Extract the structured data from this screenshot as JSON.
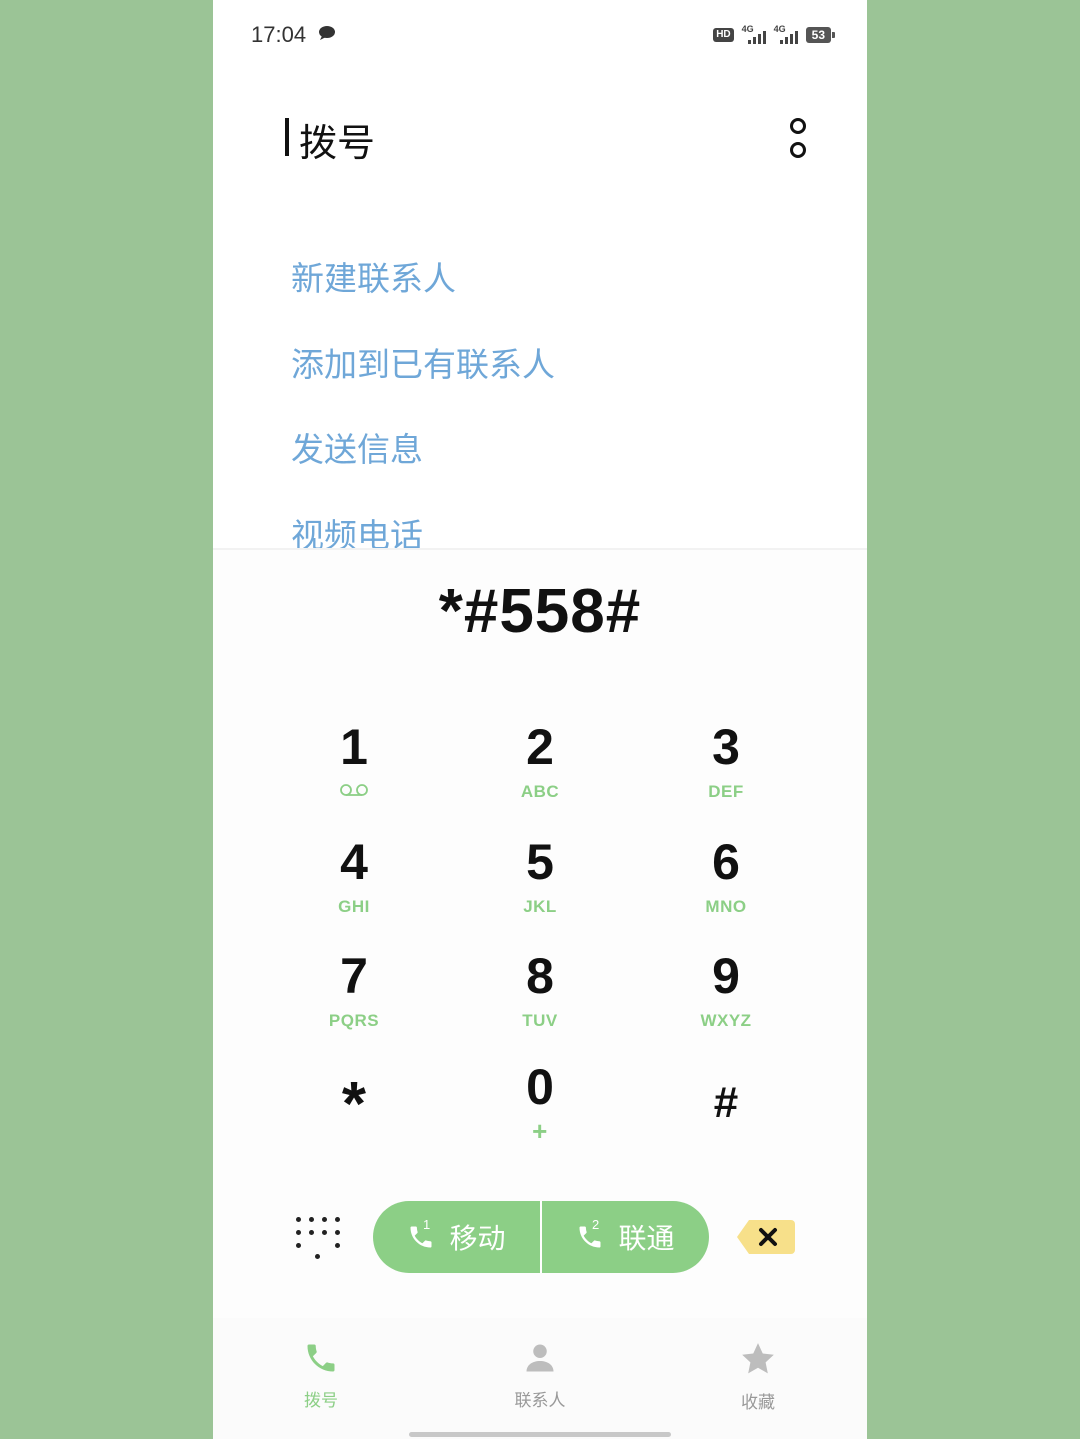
{
  "status_bar": {
    "time": "17:04",
    "icons": [
      "message-icon",
      "hd-icon",
      "4g-signal-sim1-icon",
      "4g-signal-sim2-icon"
    ],
    "hd_label": "HD",
    "network_label": "4G",
    "battery": "53"
  },
  "header": {
    "title": "拨号",
    "more_icon": "more-vertical-icon"
  },
  "menu": {
    "items": [
      {
        "label": "新建联系人"
      },
      {
        "label": "添加到已有联系人"
      },
      {
        "label": "发送信息"
      },
      {
        "label": "视频电话"
      }
    ]
  },
  "dialer": {
    "number": "*#558#",
    "keys": [
      {
        "digit": "1",
        "letters": "",
        "icon": "voicemail-icon"
      },
      {
        "digit": "2",
        "letters": "ABC"
      },
      {
        "digit": "3",
        "letters": "DEF"
      },
      {
        "digit": "4",
        "letters": "GHI"
      },
      {
        "digit": "5",
        "letters": "JKL"
      },
      {
        "digit": "6",
        "letters": "MNO"
      },
      {
        "digit": "7",
        "letters": "PQRS"
      },
      {
        "digit": "8",
        "letters": "TUV"
      },
      {
        "digit": "9",
        "letters": "WXYZ"
      },
      {
        "digit": "*",
        "letters": ""
      },
      {
        "digit": "0",
        "letters": "+"
      },
      {
        "digit": "#",
        "letters": ""
      }
    ],
    "call_buttons": [
      {
        "sim": "1",
        "label": "移动"
      },
      {
        "sim": "2",
        "label": "联通"
      }
    ],
    "colors": {
      "accent": "#8ccf86",
      "delete_bg": "#f7e08a"
    }
  },
  "bottom_nav": {
    "items": [
      {
        "label": "拨号",
        "icon": "phone-icon",
        "active": true
      },
      {
        "label": "联系人",
        "icon": "person-icon",
        "active": false
      },
      {
        "label": "收藏",
        "icon": "star-icon",
        "active": false
      }
    ]
  },
  "colors": {
    "background": "#9bc496",
    "menu_text": "#6fa7d8"
  }
}
